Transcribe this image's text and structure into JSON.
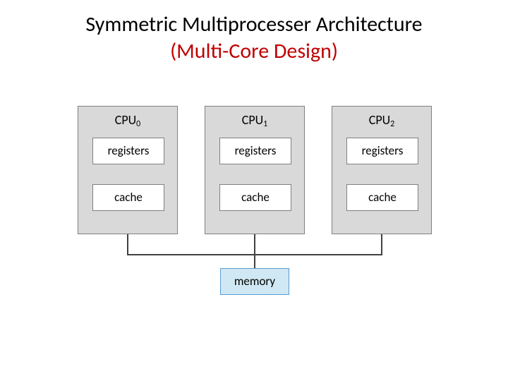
{
  "title": {
    "line1": "Symmetric Multiprocesser Architecture",
    "line2": "(Multi-Core Design)"
  },
  "cpus": [
    {
      "label_prefix": "CPU",
      "label_sub": "0",
      "registers": "registers",
      "cache": "cache"
    },
    {
      "label_prefix": "CPU",
      "label_sub": "1",
      "registers": "registers",
      "cache": "cache"
    },
    {
      "label_prefix": "CPU",
      "label_sub": "2",
      "registers": "registers",
      "cache": "cache"
    }
  ],
  "memory_label": "memory"
}
